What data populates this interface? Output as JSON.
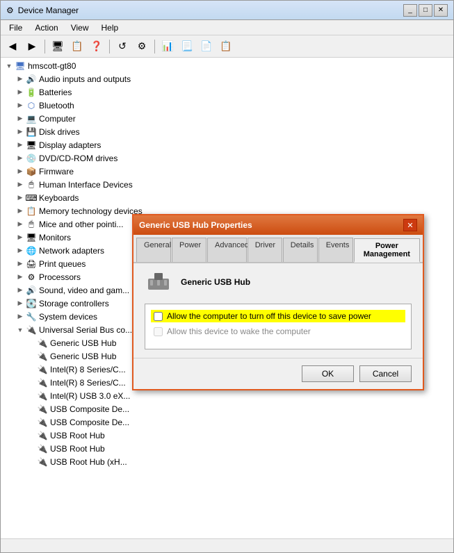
{
  "window": {
    "title": "Device Manager",
    "icon": "⚙"
  },
  "menu": {
    "items": [
      "File",
      "Action",
      "View",
      "Help"
    ]
  },
  "toolbar": {
    "buttons": [
      "◀",
      "▶",
      "↑",
      "⬛",
      "⚙",
      "🔍",
      "✓",
      "↺",
      "⛭",
      "❓"
    ]
  },
  "tree": {
    "root": "hmscott-gt80",
    "items": [
      {
        "id": "audio",
        "label": "Audio inputs and outputs",
        "icon": "audio",
        "indent": 1,
        "expanded": false
      },
      {
        "id": "batteries",
        "label": "Batteries",
        "icon": "battery",
        "indent": 1,
        "expanded": false
      },
      {
        "id": "bluetooth",
        "label": "Bluetooth",
        "icon": "bluetooth",
        "indent": 1,
        "expanded": false
      },
      {
        "id": "computer",
        "label": "Computer",
        "icon": "cpu",
        "indent": 1,
        "expanded": false
      },
      {
        "id": "diskdrives",
        "label": "Disk drives",
        "icon": "disk",
        "indent": 1,
        "expanded": false
      },
      {
        "id": "displayadapters",
        "label": "Display adapters",
        "icon": "display",
        "indent": 1,
        "expanded": false
      },
      {
        "id": "dvd",
        "label": "DVD/CD-ROM drives",
        "icon": "dvd",
        "indent": 1,
        "expanded": false
      },
      {
        "id": "firmware",
        "label": "Firmware",
        "icon": "firmware",
        "indent": 1,
        "expanded": false
      },
      {
        "id": "hid",
        "label": "Human Interface Devices",
        "icon": "hid",
        "indent": 1,
        "expanded": false
      },
      {
        "id": "keyboards",
        "label": "Keyboards",
        "icon": "keyboard",
        "indent": 1,
        "expanded": false
      },
      {
        "id": "memory",
        "label": "Memory technology devices",
        "icon": "memory",
        "indent": 1,
        "expanded": false
      },
      {
        "id": "mice",
        "label": "Mice and other pointi...",
        "icon": "mice",
        "indent": 1,
        "expanded": false
      },
      {
        "id": "monitors",
        "label": "Monitors",
        "icon": "monitor",
        "indent": 1,
        "expanded": false
      },
      {
        "id": "network",
        "label": "Network adapters",
        "icon": "network",
        "indent": 1,
        "expanded": false
      },
      {
        "id": "print",
        "label": "Print queues",
        "icon": "print",
        "indent": 1,
        "expanded": false
      },
      {
        "id": "processors",
        "label": "Processors",
        "icon": "processor",
        "indent": 1,
        "expanded": false
      },
      {
        "id": "sound",
        "label": "Sound, video and gam...",
        "icon": "sound",
        "indent": 1,
        "expanded": false
      },
      {
        "id": "storage",
        "label": "Storage controllers",
        "icon": "storage",
        "indent": 1,
        "expanded": false
      },
      {
        "id": "system",
        "label": "System devices",
        "icon": "system",
        "indent": 1,
        "expanded": false
      },
      {
        "id": "usb",
        "label": "Universal Serial Bus co...",
        "icon": "usb",
        "indent": 1,
        "expanded": true
      },
      {
        "id": "usb1",
        "label": "Generic USB Hub",
        "icon": "usb-device",
        "indent": 2,
        "expanded": false
      },
      {
        "id": "usb2",
        "label": "Generic USB Hub",
        "icon": "usb-device",
        "indent": 2,
        "expanded": false
      },
      {
        "id": "usb3",
        "label": "Intel(R) 8 Series/C...",
        "icon": "usb-device",
        "indent": 2,
        "expanded": false
      },
      {
        "id": "usb4",
        "label": "Intel(R) 8 Series/C...",
        "icon": "usb-device",
        "indent": 2,
        "expanded": false
      },
      {
        "id": "usb5",
        "label": "Intel(R) USB 3.0 eX...",
        "icon": "usb-device",
        "indent": 2,
        "expanded": false
      },
      {
        "id": "usb6",
        "label": "USB Composite De...",
        "icon": "usb-device",
        "indent": 2,
        "expanded": false
      },
      {
        "id": "usb7",
        "label": "USB Composite De...",
        "icon": "usb-device",
        "indent": 2,
        "expanded": false
      },
      {
        "id": "usb8",
        "label": "USB Root Hub",
        "icon": "usb-device",
        "indent": 2,
        "expanded": false
      },
      {
        "id": "usb9",
        "label": "USB Root Hub",
        "icon": "usb-device",
        "indent": 2,
        "expanded": false
      },
      {
        "id": "usb10",
        "label": "USB Root Hub (xH...",
        "icon": "usb-device",
        "indent": 2,
        "expanded": false
      }
    ]
  },
  "dialog": {
    "title": "Generic USB Hub Properties",
    "device_name": "Generic USB Hub",
    "tabs": [
      "General",
      "Power",
      "Advanced",
      "Driver",
      "Details",
      "Events",
      "Power Management"
    ],
    "active_tab": "Power Management",
    "checkbox1": {
      "label": "Allow the computer to turn off this device to save power",
      "checked": false,
      "highlighted": true,
      "disabled": false
    },
    "checkbox2": {
      "label": "Allow this device to wake the computer",
      "checked": false,
      "highlighted": false,
      "disabled": true
    },
    "btn_ok": "OK",
    "btn_cancel": "Cancel"
  }
}
